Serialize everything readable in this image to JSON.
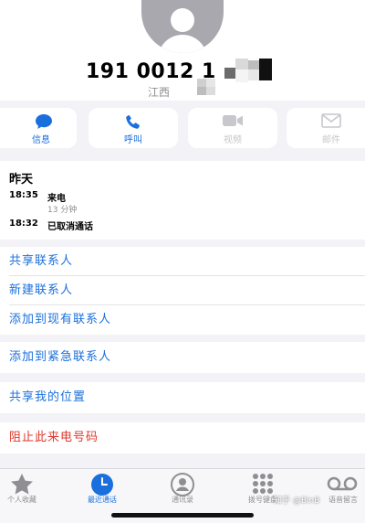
{
  "contact": {
    "phone_number": "191 0012 1",
    "location": "江西"
  },
  "actions": [
    {
      "label": "信息",
      "icon": "message-icon",
      "enabled": true
    },
    {
      "label": "呼叫",
      "icon": "phone-icon",
      "enabled": true
    },
    {
      "label": "视频",
      "icon": "video-icon",
      "enabled": false
    },
    {
      "label": "邮件",
      "icon": "mail-icon",
      "enabled": false
    }
  ],
  "recent": {
    "day": "昨天",
    "calls": [
      {
        "time": "18:35",
        "type": "来电",
        "duration": "13 分钟"
      },
      {
        "time": "18:32",
        "type": "已取消通话",
        "duration": ""
      }
    ]
  },
  "menu": {
    "share_contact": "共享联系人",
    "new_contact": "新建联系人",
    "add_existing": "添加到现有联系人",
    "add_emergency": "添加到紧急联系人",
    "share_location": "共享我的位置",
    "block_caller": "阻止此来电号码"
  },
  "tabs": [
    {
      "label": "个人收藏",
      "icon": "star-icon",
      "active": false
    },
    {
      "label": "最近通话",
      "icon": "clock-icon",
      "active": true
    },
    {
      "label": "通讯录",
      "icon": "contacts-icon",
      "active": false
    },
    {
      "label": "拨号键盘",
      "icon": "keypad-icon",
      "active": false
    },
    {
      "label": "语音留言",
      "icon": "voicemail-icon",
      "active": false
    }
  ],
  "watermark": "知乎 @BinB",
  "colors": {
    "accent": "#1a6fdc",
    "danger": "#e0362b",
    "disabled": "#c7c7cc",
    "background": "#f2f2f7"
  }
}
